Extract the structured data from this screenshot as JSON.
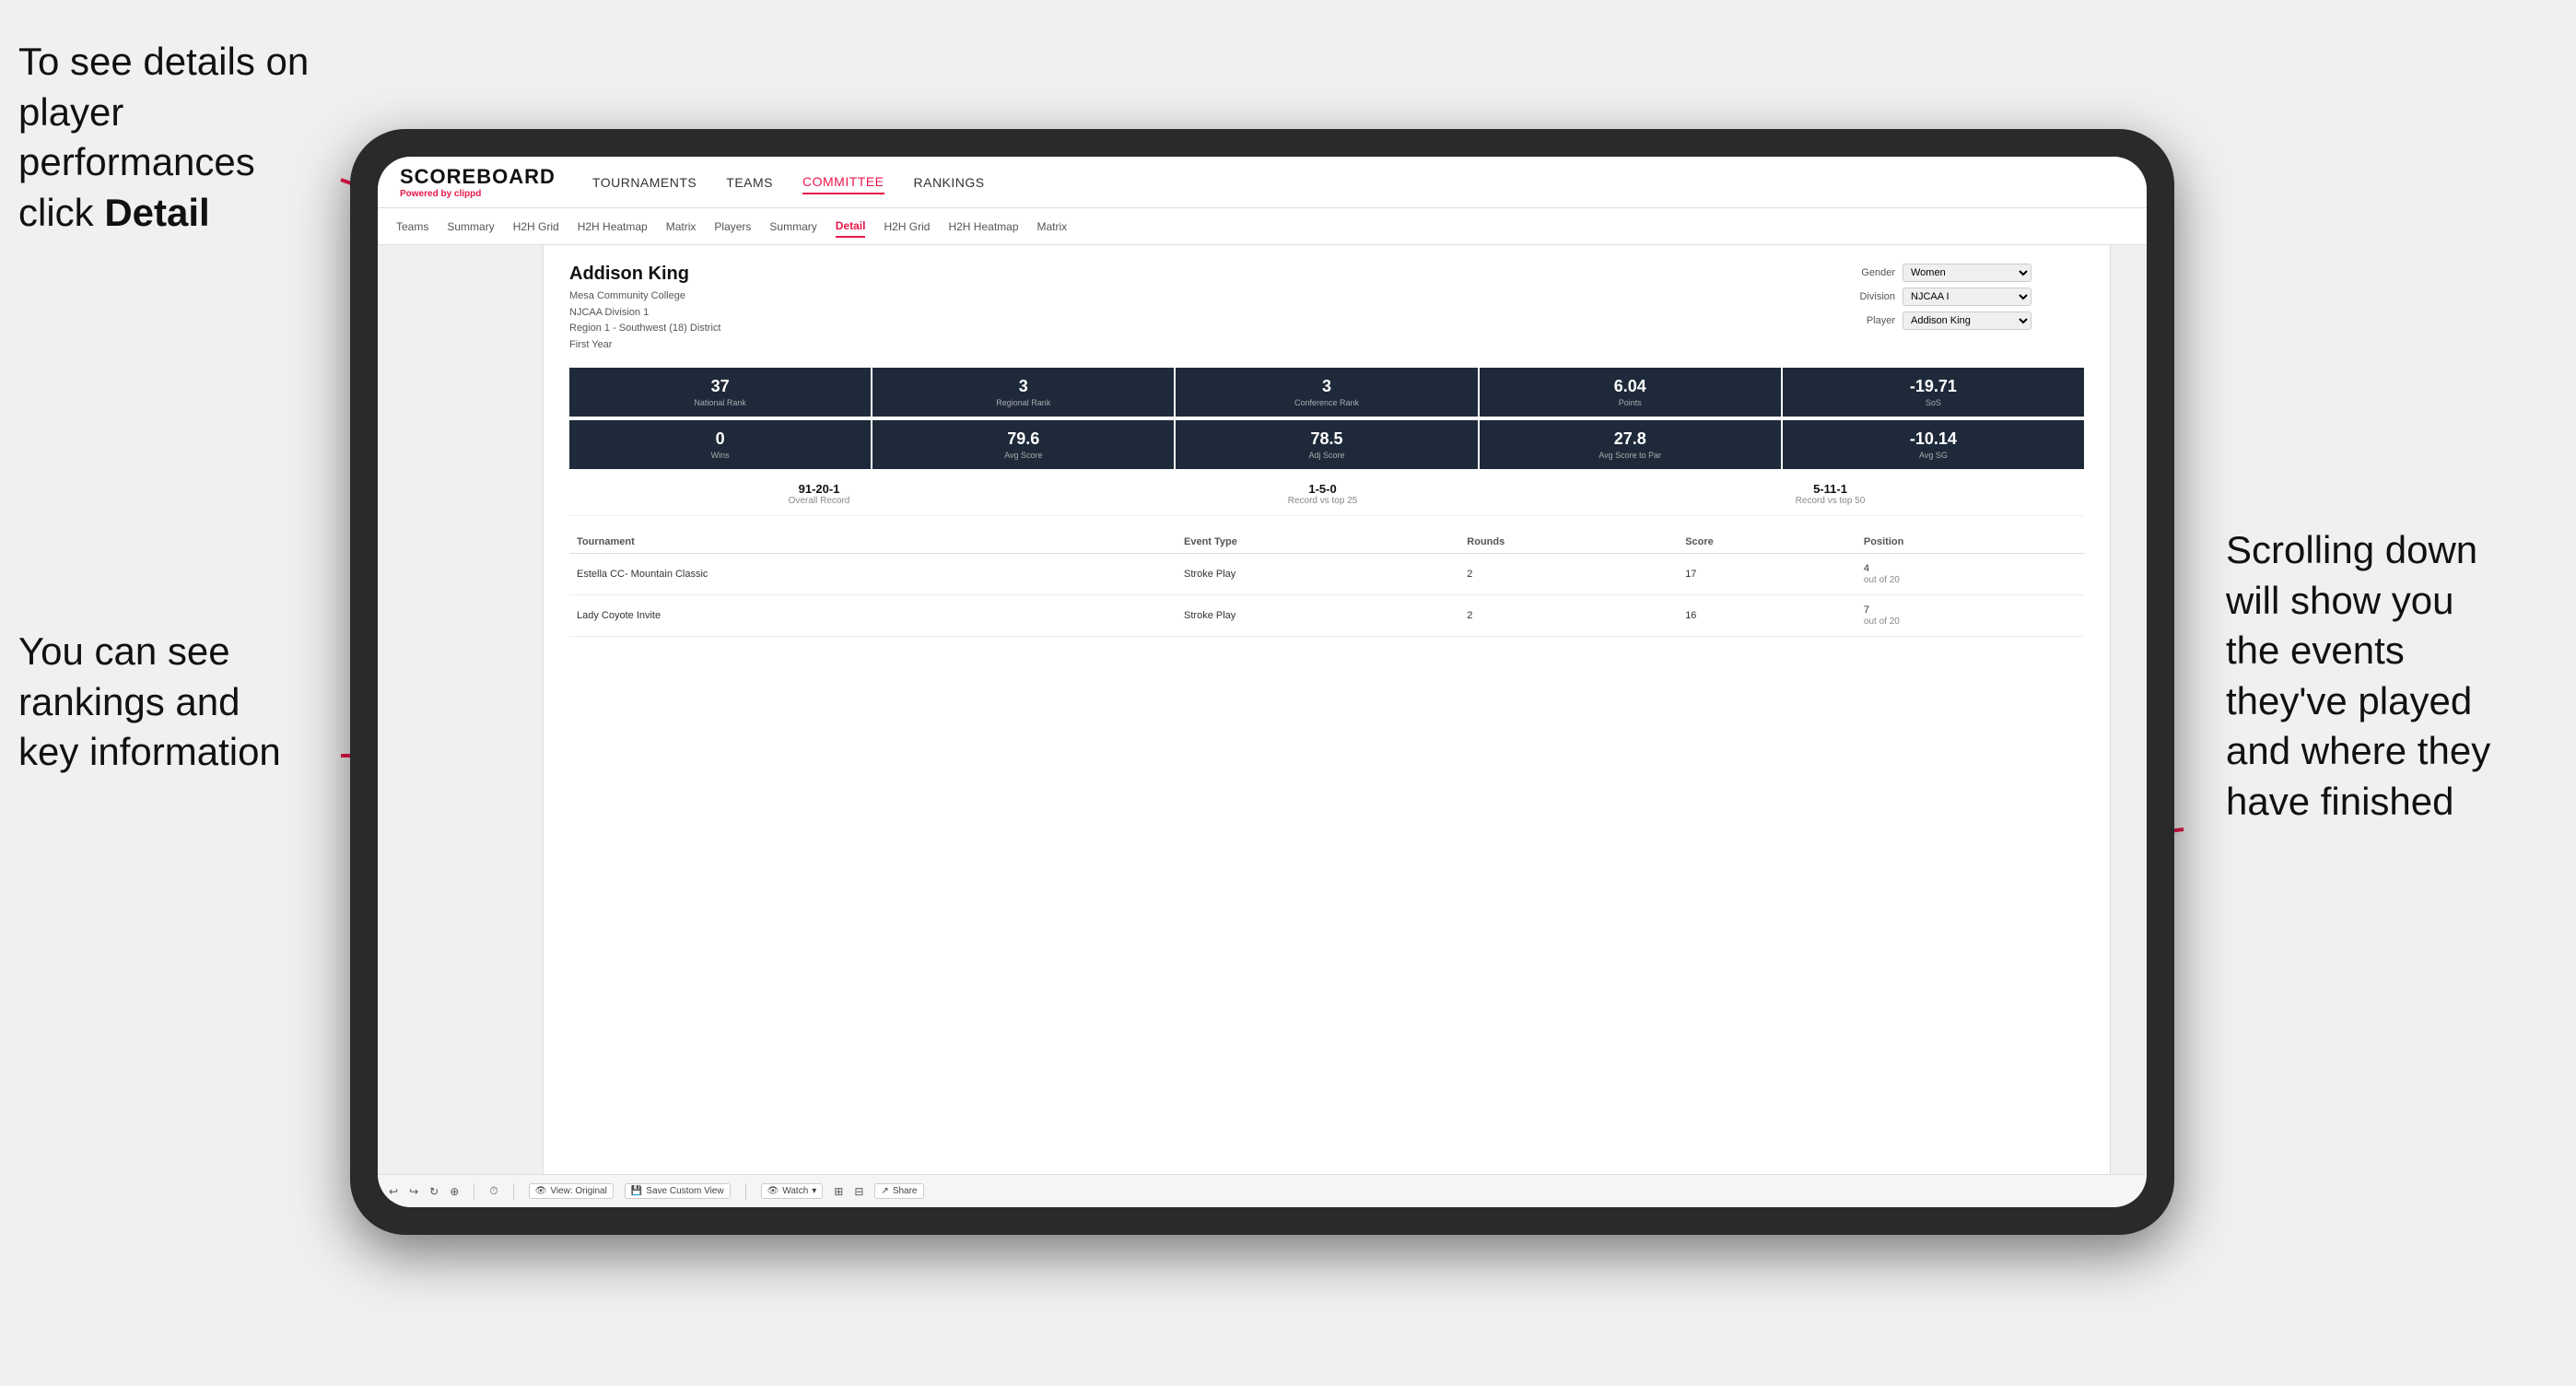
{
  "annotations": {
    "top_left": "To see details on player performances click ",
    "top_left_bold": "Detail",
    "bottom_left_line1": "You can see",
    "bottom_left_line2": "rankings and",
    "bottom_left_line3": "key information",
    "right_line1": "Scrolling down",
    "right_line2": "will show you",
    "right_line3": "the events",
    "right_line4": "they've played",
    "right_line5": "and where they",
    "right_line6": "have finished"
  },
  "top_nav": {
    "logo": "SCOREBOARD",
    "logo_sub": "Powered by ",
    "logo_brand": "clippd",
    "items": [
      "TOURNAMENTS",
      "TEAMS",
      "COMMITTEE",
      "RANKINGS"
    ]
  },
  "sub_nav": {
    "items": [
      "Teams",
      "Summary",
      "H2H Grid",
      "H2H Heatmap",
      "Matrix",
      "Players",
      "Summary",
      "Detail",
      "H2H Grid",
      "H2H Heatmap",
      "Matrix"
    ],
    "active": "Detail"
  },
  "player": {
    "name": "Addison King",
    "college": "Mesa Community College",
    "division": "NJCAA Division 1",
    "region": "Region 1 - Southwest (18) District",
    "year": "First Year"
  },
  "controls": {
    "gender_label": "Gender",
    "gender_value": "Women",
    "division_label": "Division",
    "division_value": "NJCAA I",
    "player_label": "Player",
    "player_value": "Addison King"
  },
  "stats_row1": [
    {
      "value": "37",
      "label": "National Rank"
    },
    {
      "value": "3",
      "label": "Regional Rank"
    },
    {
      "value": "3",
      "label": "Conference Rank"
    },
    {
      "value": "6.04",
      "label": "Points"
    },
    {
      "value": "-19.71",
      "label": "SoS"
    }
  ],
  "stats_row2": [
    {
      "value": "0",
      "label": "Wins"
    },
    {
      "value": "79.6",
      "label": "Avg Score"
    },
    {
      "value": "78.5",
      "label": "Adj Score"
    },
    {
      "value": "27.8",
      "label": "Avg Score to Par"
    },
    {
      "value": "-10.14",
      "label": "Avg SG"
    }
  ],
  "records": [
    {
      "value": "91-20-1",
      "label": "Overall Record"
    },
    {
      "value": "1-5-0",
      "label": "Record vs top 25"
    },
    {
      "value": "5-11-1",
      "label": "Record vs top 50"
    }
  ],
  "table": {
    "headers": [
      "Tournament",
      "",
      "Event Type",
      "Rounds",
      "Score",
      "Position"
    ],
    "rows": [
      {
        "tournament": "Estella CC- Mountain Classic",
        "event_type": "Stroke Play",
        "rounds": "2",
        "score": "17",
        "position": "4",
        "position_detail": "out of 20"
      },
      {
        "tournament": "Lady Coyote Invite",
        "event_type": "Stroke Play",
        "rounds": "2",
        "score": "16",
        "position": "7",
        "position_detail": "out of 20"
      }
    ]
  },
  "toolbar": {
    "view_label": "View: Original",
    "save_label": "Save Custom View",
    "watch_label": "Watch",
    "share_label": "Share"
  }
}
